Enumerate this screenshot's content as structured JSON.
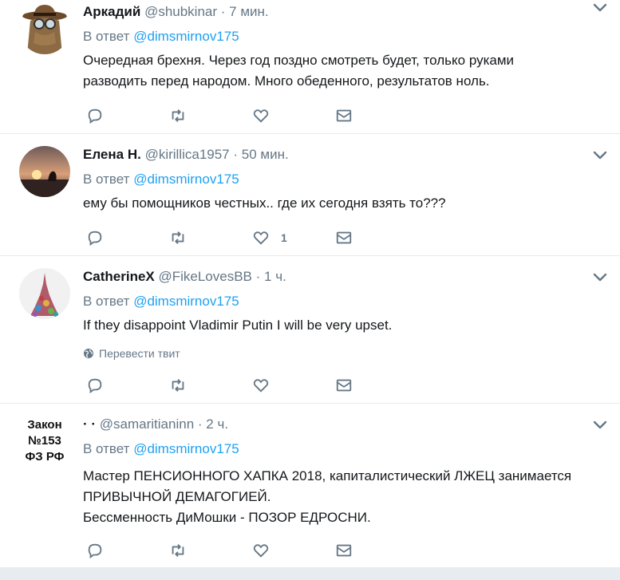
{
  "reply_prefix": "В ответ",
  "tweets": [
    {
      "name": "Аркадий",
      "handle": "@shubkinar",
      "sep": "·",
      "time": "7 мин.",
      "reply_to": "@dimsmirnov175",
      "lines": [
        "Очередная брехня. Через год поздно смотреть будет, только руками",
        "разводить перед народом. Много обеденного, результатов ноль."
      ],
      "likes": ""
    },
    {
      "name": "Елена Н.",
      "handle": "@kirillica1957",
      "sep": "·",
      "time": "50 мин.",
      "reply_to": "@dimsmirnov175",
      "lines": [
        "ему бы помощников честных.. где их сегодня взять то???"
      ],
      "likes": "1"
    },
    {
      "name": "CatherineX",
      "handle": "@FikeLovesBB",
      "sep": "·",
      "time": "1 ч.",
      "reply_to": "@dimsmirnov175",
      "lines": [
        "If they disappoint Vladimir Putin I will be very upset."
      ],
      "translate": "Перевести твит",
      "likes": ""
    },
    {
      "name": "· ·",
      "handle": "@samaritianinn",
      "sep": "·",
      "time": "2 ч.",
      "reply_to": "@dimsmirnov175",
      "lines": [
        "Мастер ПЕНСИОННОГО ХАПКА 2018, капиталистический ЛЖЕЦ занимается",
        "ПРИВЫЧНОЙ ДЕМАГОГИЕЙ.",
        "Бессменность ДиМошки - ПОЗОР ЕДРОСНИ."
      ],
      "avatar_text": [
        "Закон",
        "№153",
        "ФЗ РФ"
      ],
      "likes": ""
    }
  ],
  "colors": {
    "link": "#1da1f2",
    "muted": "#657786",
    "divider": "#e6ecf0"
  }
}
